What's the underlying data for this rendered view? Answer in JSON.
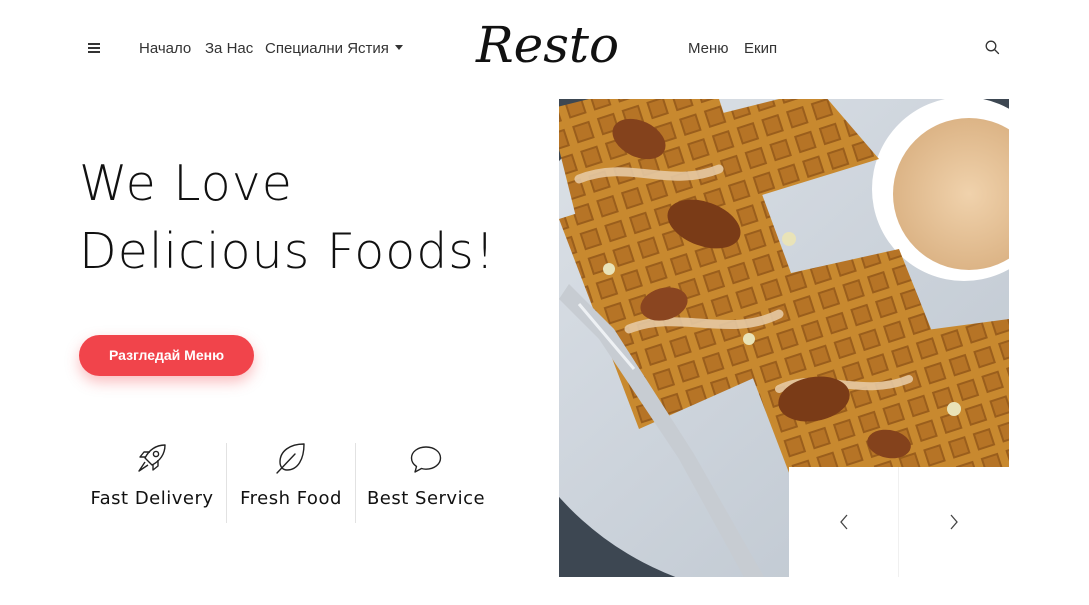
{
  "nav": {
    "home": "Начало",
    "about": "За Нас",
    "specials": "Специални Ястия",
    "menu": "Меню",
    "team": "Екип",
    "logo": "Resto"
  },
  "hero": {
    "title_line1": "We Love",
    "title_line2": "Delicious Foods!",
    "cta": "Разгледай Меню"
  },
  "features": [
    {
      "label": "Fast Delivery",
      "icon": "rocket-icon"
    },
    {
      "label": "Fresh Food",
      "icon": "leaf-icon"
    },
    {
      "label": "Best Service",
      "icon": "chat-bubble-icon"
    }
  ],
  "colors": {
    "accent": "#f1444b"
  }
}
